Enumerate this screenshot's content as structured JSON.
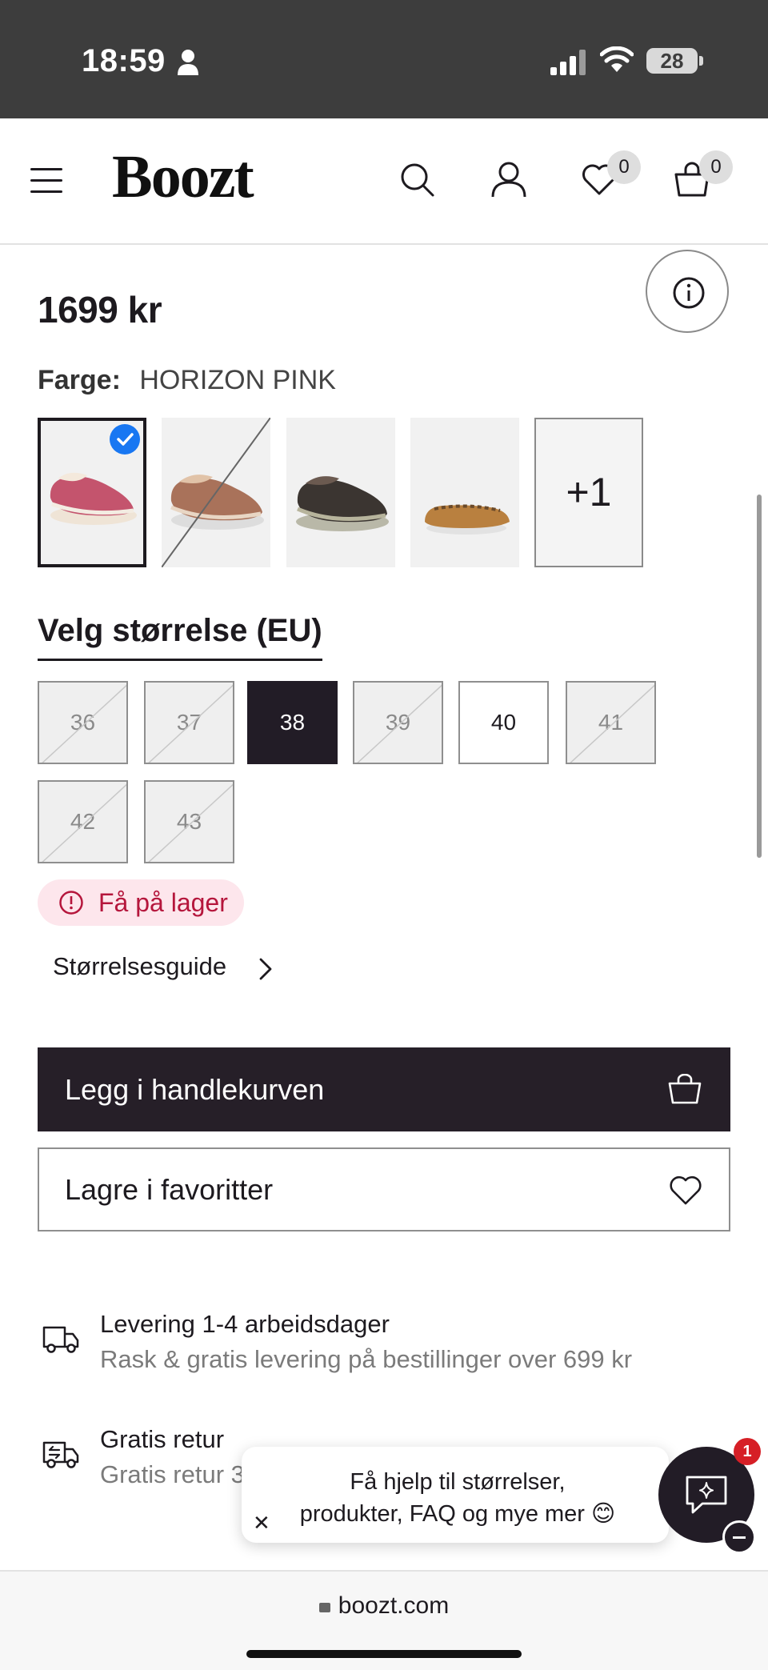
{
  "status_bar": {
    "time": "18:59",
    "battery": "28"
  },
  "header": {
    "logo": "Boozt",
    "wishlist_count": "0",
    "cart_count": "0"
  },
  "product": {
    "price": "1699 kr",
    "color_label": "Farge:",
    "color_value": "HORIZON PINK",
    "more_colors": "+1"
  },
  "sizes": {
    "title": "Velg størrelse (EU)",
    "options": [
      {
        "label": "36",
        "state": "unavailable"
      },
      {
        "label": "37",
        "state": "unavailable"
      },
      {
        "label": "38",
        "state": "selected"
      },
      {
        "label": "39",
        "state": "unavailable"
      },
      {
        "label": "40",
        "state": "available"
      },
      {
        "label": "41",
        "state": "unavailable"
      },
      {
        "label": "42",
        "state": "unavailable"
      },
      {
        "label": "43",
        "state": "unavailable"
      }
    ],
    "stock_status": "Få på lager",
    "size_guide": "Størrelsesguide"
  },
  "actions": {
    "add_to_cart": "Legg i handlekurven",
    "save_favorite": "Lagre i favoritter"
  },
  "usps": [
    {
      "title": "Levering 1-4 arbeidsdager",
      "subtitle": "Rask & gratis levering på bestillinger over 699 kr",
      "icon": "truck-icon"
    },
    {
      "title": "Gratis retur",
      "subtitle": "Gratis retur 3",
      "icon": "return-truck-icon"
    }
  ],
  "chat": {
    "message_line1": "Få hjelp til størrelser,",
    "message_line2": "produkter, FAQ og mye mer 😊",
    "badge": "1"
  },
  "browser": {
    "url": "boozt.com"
  },
  "colors": {
    "dark": "#221c26",
    "stock_bg": "#fde6ec",
    "stock_text": "#b5163c",
    "check": "#1877f2"
  }
}
